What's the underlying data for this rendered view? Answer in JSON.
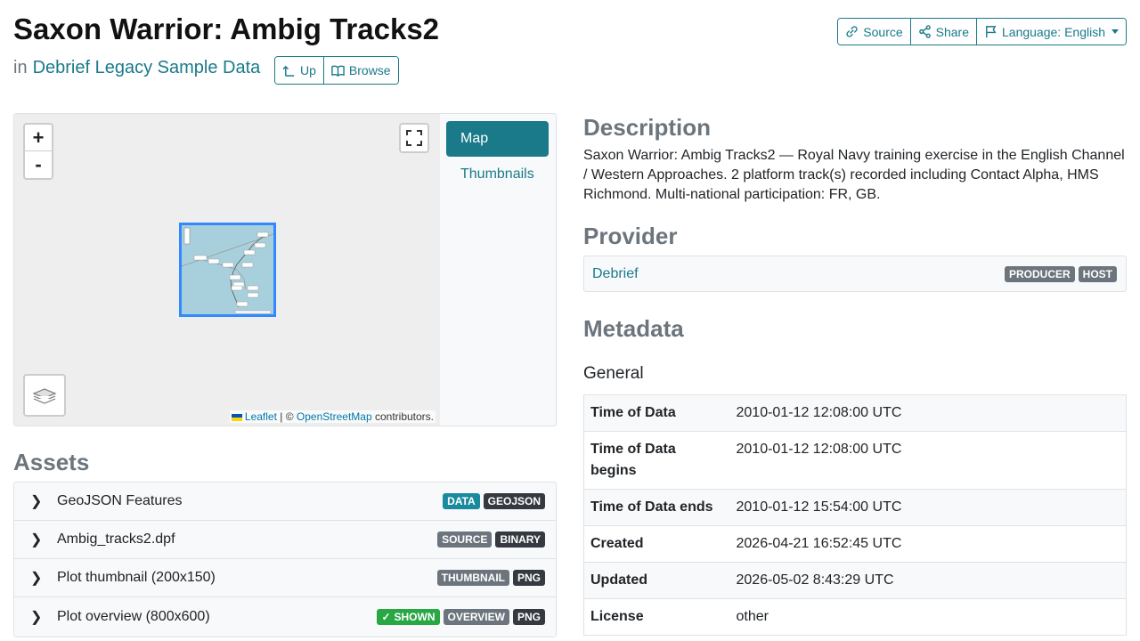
{
  "header": {
    "title": "Saxon Warrior: Ambig Tracks2",
    "in_prefix": "in",
    "collection": "Debrief Legacy Sample Data",
    "up_label": "Up",
    "browse_label": "Browse",
    "source_label": "Source",
    "share_label": "Share",
    "language_label": "Language: English"
  },
  "map": {
    "zoom_in": "+",
    "zoom_out": "-",
    "attribution_leaflet": "Leaflet",
    "attribution_sep": "| ©",
    "attribution_osm": "OpenStreetMap",
    "attribution_suffix": "contributors.",
    "tabs": [
      "Map",
      "Thumbnails"
    ]
  },
  "assets": {
    "heading": "Assets",
    "items": [
      {
        "name": "GeoJSON Features",
        "badges": [
          "DATA",
          "GEOJSON"
        ]
      },
      {
        "name": "Ambig_tracks2.dpf",
        "badges": [
          "SOURCE",
          "BINARY"
        ]
      },
      {
        "name": "Plot thumbnail (200x150)",
        "badges": [
          "THUMBNAIL",
          "PNG"
        ]
      },
      {
        "name": "Plot overview (800x600)",
        "badges": [
          "SHOWN",
          "OVERVIEW",
          "PNG"
        ]
      }
    ]
  },
  "description": {
    "heading": "Description",
    "text": "Saxon Warrior: Ambig Tracks2 — Royal Navy training exercise in the English Channel / Western Approaches. 2 platform track(s) recorded including Contact Alpha, HMS Richmond. Multi-national participation: FR, GB."
  },
  "provider": {
    "heading": "Provider",
    "name": "Debrief",
    "roles": [
      "PRODUCER",
      "HOST"
    ]
  },
  "metadata": {
    "heading": "Metadata",
    "section": "General",
    "rows": [
      {
        "key": "Time of Data",
        "value": "2010-01-12 12:08:00 UTC"
      },
      {
        "key": "Time of Data begins",
        "value": "2010-01-12 12:08:00 UTC"
      },
      {
        "key": "Time of Data ends",
        "value": "2010-01-12 15:54:00 UTC"
      },
      {
        "key": "Created",
        "value": "2026-04-21 16:52:45 UTC"
      },
      {
        "key": "Updated",
        "value": "2026-05-02 8:43:29 UTC"
      },
      {
        "key": "License",
        "value": "other"
      }
    ]
  },
  "colors": {
    "accent": "#1a7a8a",
    "badge_data": "#1a8a9e",
    "badge_dark": "#343a40",
    "badge_grey": "#6c757d",
    "badge_shown": "#28a745",
    "map_selection": "#3388ff"
  }
}
